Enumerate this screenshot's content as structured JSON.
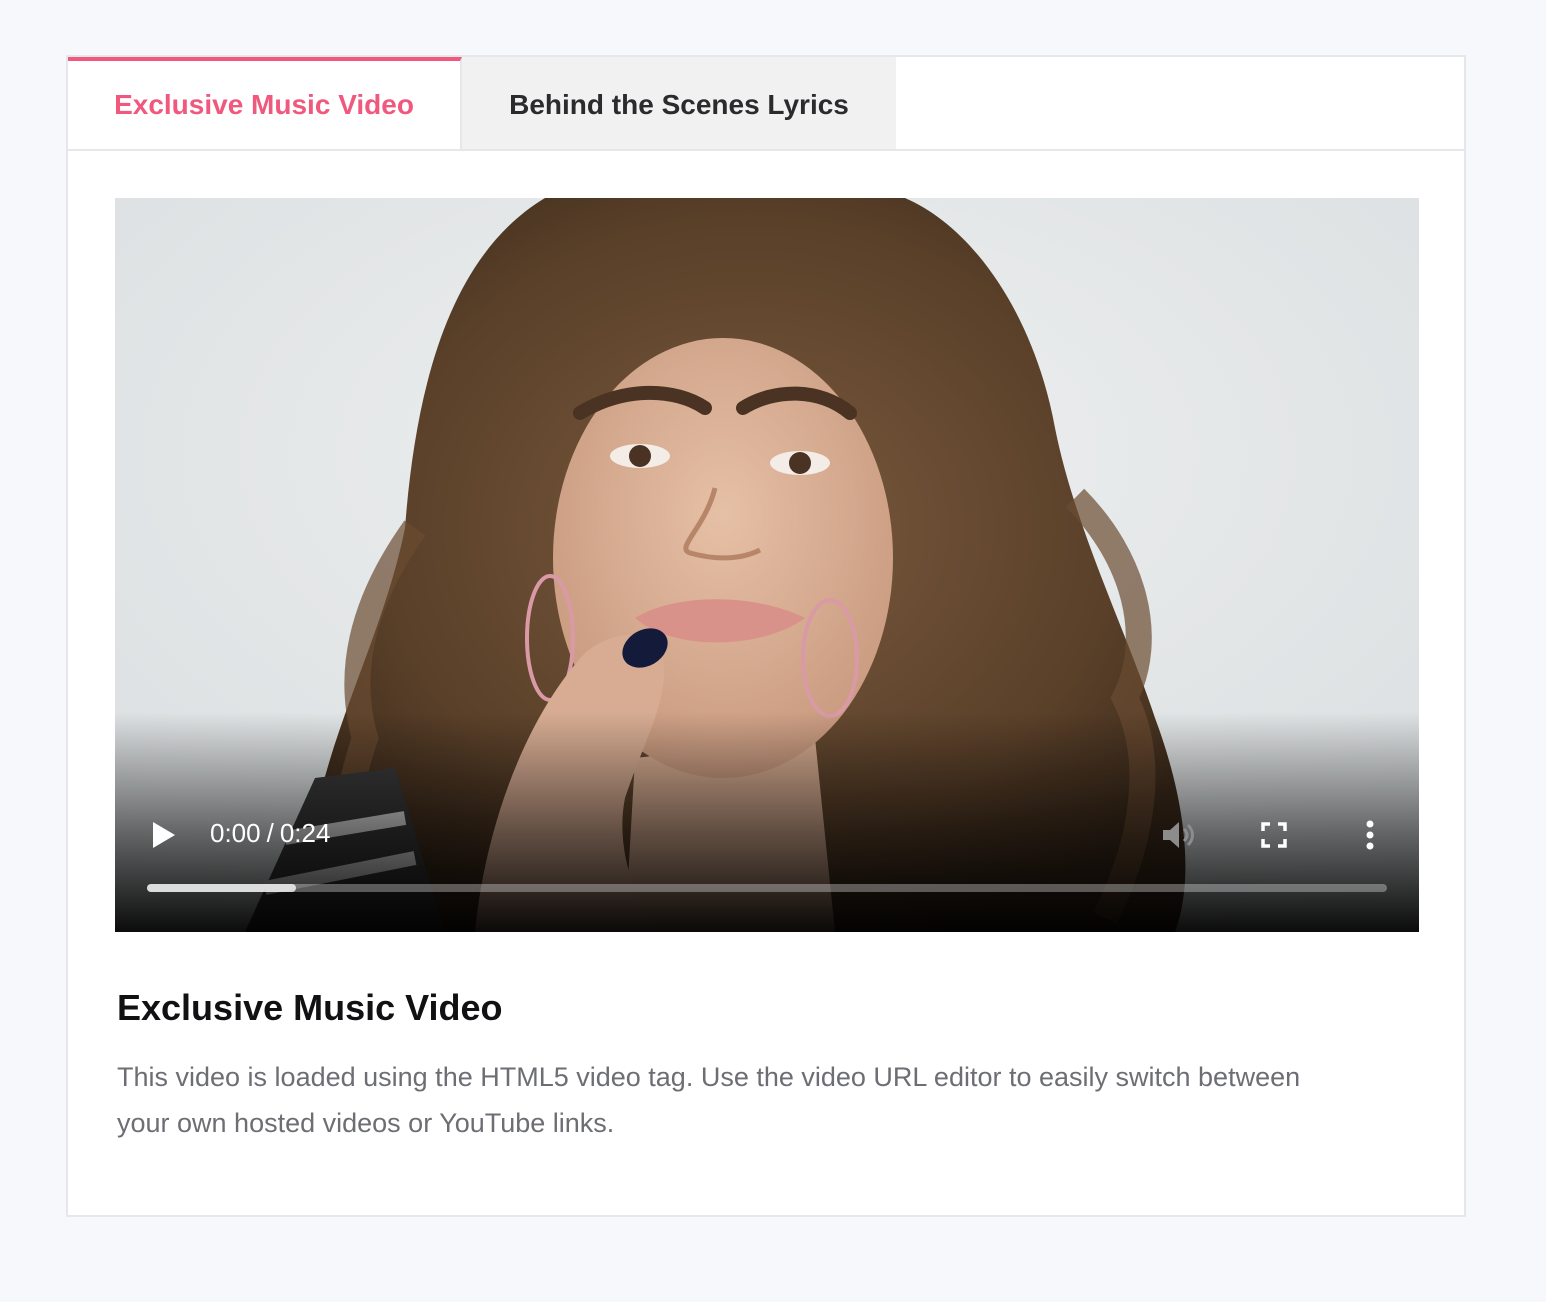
{
  "tabs": [
    {
      "label": "Exclusive Music Video",
      "active": true
    },
    {
      "label": "Behind the Scenes Lyrics",
      "active": false
    }
  ],
  "video": {
    "current_time": "0:00",
    "separator": "/",
    "duration": "0:24",
    "buffered_fraction": 0.12,
    "icons": [
      "play-icon",
      "volume-icon",
      "fullscreen-icon",
      "more-options-icon"
    ]
  },
  "content": {
    "title": "Exclusive Music Video",
    "description": "This video is loaded using the HTML5 video tag. Use the video URL editor to easily switch between your own hosted videos or YouTube links."
  },
  "colors": {
    "accent": "#f0587e",
    "tab_inactive_bg": "#f1f1f2",
    "page_bg": "#f7f8fc",
    "text_muted": "#6d6e73"
  }
}
